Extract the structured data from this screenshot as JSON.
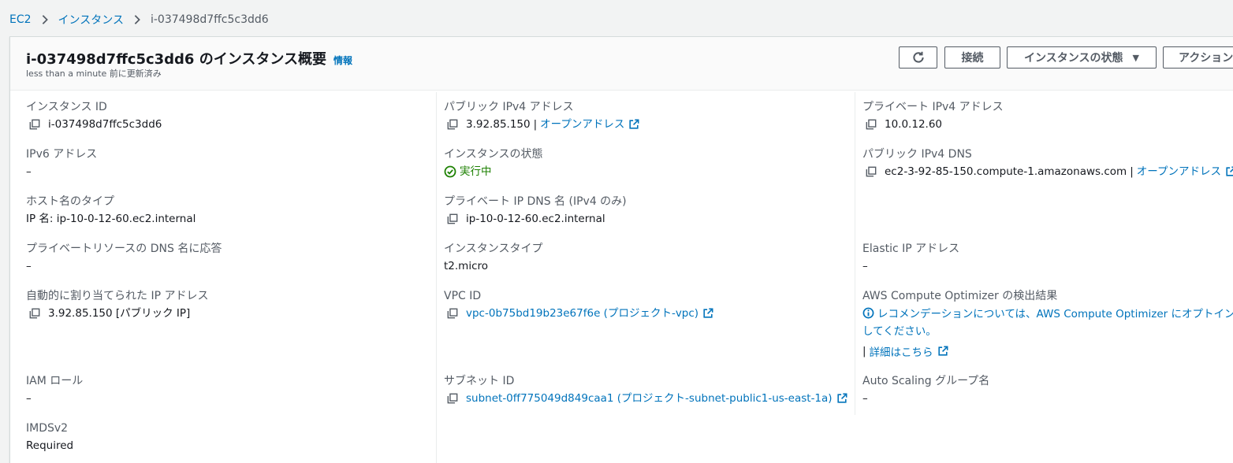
{
  "breadcrumb": {
    "items": [
      "EC2",
      "インスタンス"
    ],
    "current": "i-037498d7ffc5c3dd6"
  },
  "header": {
    "title": "i-037498d7ffc5c3dd6 のインスタンス概要",
    "info_label": "情報",
    "updated": "less than a minute 前に更新済み",
    "buttons": {
      "connect": "接続",
      "instance_state": "インスタンスの状態",
      "actions": "アクション"
    }
  },
  "details": {
    "instance_id": {
      "label": "インスタンス ID",
      "value": "i-037498d7ffc5c3dd6"
    },
    "ipv6": {
      "label": "IPv6 アドレス",
      "value": "–"
    },
    "hostname_type": {
      "label": "ホスト名のタイプ",
      "value": "IP 名: ip-10-0-12-60.ec2.internal"
    },
    "private_dns_answer": {
      "label": "プライベートリソースの DNS 名に応答",
      "value": "–"
    },
    "auto_ip": {
      "label": "自動的に割り当てられた IP アドレス",
      "value": "3.92.85.150 [パブリック IP]"
    },
    "iam_role": {
      "label": "IAM ロール",
      "value": "–"
    },
    "imdsv2": {
      "label": "IMDSv2",
      "value": "Required"
    },
    "public_ipv4": {
      "label": "パブリック IPv4 アドレス",
      "value": "3.92.85.150",
      "sep": "|",
      "link": "オープンアドレス"
    },
    "instance_state": {
      "label": "インスタンスの状態",
      "value": "実行中"
    },
    "private_ip_dns": {
      "label": "プライベート IP DNS 名 (IPv4 のみ)",
      "value": "ip-10-0-12-60.ec2.internal"
    },
    "instance_type": {
      "label": "インスタンスタイプ",
      "value": "t2.micro"
    },
    "vpc_id": {
      "label": "VPC ID",
      "value": "vpc-0b75bd19b23e67f6e (プロジェクト-vpc)"
    },
    "subnet_id": {
      "label": "サブネット ID",
      "value": "subnet-0ff775049d849caa1 (プロジェクト-subnet-public1-us-east-1a)"
    },
    "private_ipv4": {
      "label": "プライベート IPv4 アドレス",
      "value": "10.0.12.60"
    },
    "public_dns": {
      "label": "パブリック IPv4 DNS",
      "value": "ec2-3-92-85-150.compute-1.amazonaws.com",
      "sep": "|",
      "link": "オープンアドレス"
    },
    "elastic_ip": {
      "label": "Elastic IP アドレス",
      "value": "–"
    },
    "optimizer": {
      "label": "AWS Compute Optimizer の検出結果",
      "text": "レコメンデーションについては、AWS Compute Optimizer にオプトインしてください。",
      "sep": "|",
      "link": "詳細はこちら"
    },
    "asg": {
      "label": "Auto Scaling グループ名",
      "value": "–"
    }
  },
  "colors": {
    "link": "#0073bb",
    "running": "#1d8102",
    "label": "#545b64",
    "text": "#16191f"
  }
}
